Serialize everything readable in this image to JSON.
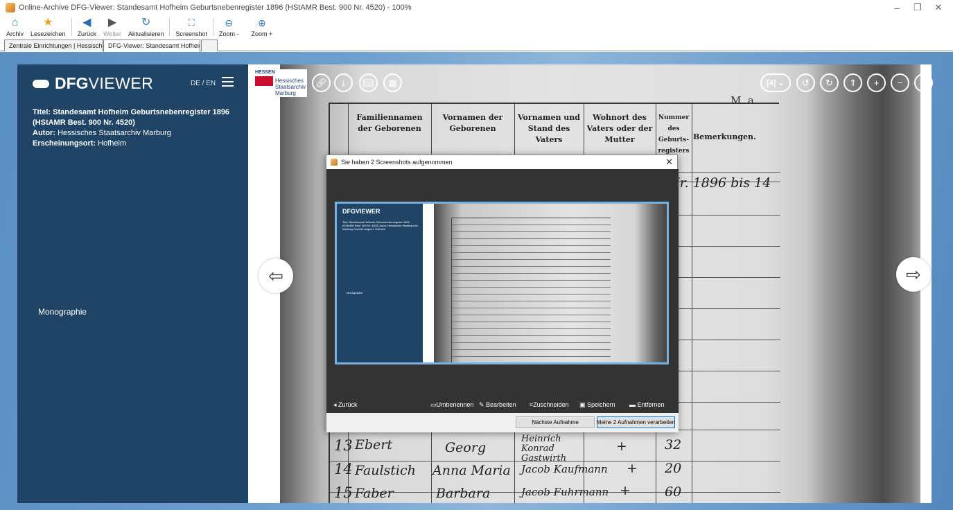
{
  "window": {
    "title": "Online-Archive DFG-Viewer: Standesamt Hofheim Geburtsnebenregister 1896 (HStAMR Best. 900 Nr. 4520) - 100%",
    "controls": [
      "–",
      "❐",
      "✕"
    ]
  },
  "toolbar": {
    "archiv": "Archiv",
    "lesezeichen": "Lesezeichen",
    "zurueck": "Zurück",
    "weiter": "Weiter",
    "aktualisieren": "Aktualisieren",
    "screenshot": "Screenshot",
    "zoom_out": "Zoom -",
    "zoom_in": "Zoom +"
  },
  "tabs": [
    {
      "label": "Zentrale Einrichtungen | Hessische",
      "close": "×"
    },
    {
      "label": "DFG-Viewer: Standesamt Hofheim",
      "close": "×"
    }
  ],
  "sidebar": {
    "logo_bold": "DFG",
    "logo_light": "VIEWER",
    "lang": "DE / EN",
    "title_label": "Titel:",
    "title_value": "Standesamt Hofheim Geburtsnebenregister 1896 (HStAMR Best. 900 Nr. 4520)",
    "author_label": "Autor:",
    "author_value": "Hessisches Staatsarchiv Marburg",
    "place_label": "Erscheinungsort:",
    "place_value": "Hofheim",
    "genre": "Monographie"
  },
  "institution": {
    "top": "HESSEN",
    "line1": "Hessisches",
    "line2": "Staatsarchiv",
    "line3": "Marburg"
  },
  "viewer": {
    "page_selector": "[4]",
    "document_header": "M. a.",
    "columns": [
      "Familiennamen der Geborenen",
      "Vornamen der Geborenen",
      "Vornamen und Stand des Vaters",
      "Wohnort des Vaters oder der Mutter",
      "Nummer des Geburts-registers",
      "Bemerkungen."
    ],
    "rows": [
      {
        "num": "13",
        "family": "Ebert",
        "given": "Georg",
        "father": "Heinrich Konrad Gastwirth",
        "dot": "+",
        "reg": "32"
      },
      {
        "num": "14",
        "family": "Faulstich",
        "given": "Anna Maria",
        "father": "Jacob Kaufmann",
        "dot": "+",
        "reg": "20"
      },
      {
        "num": "15",
        "family": "Faber",
        "given": "Barbara",
        "father": "Jacob Fuhrmann",
        "dot": "+",
        "reg": "60"
      }
    ],
    "remark": "Nr. 1896 bis 14"
  },
  "dialog": {
    "title": "Sie haben 2 Screenshots aufgenommen",
    "close": "✕",
    "back": "Zurück",
    "rename": "Umbenennen",
    "edit": "Bearbeiten",
    "crop": "Zuschneiden",
    "save": "Speichern",
    "remove": "Entfernen",
    "next": "Nächste Aufnahme",
    "process": "Meine 2 Aufnahmen verarbeiten",
    "thumb": {
      "logo": "DFGVIEWER",
      "meta": "Titel: Standesamt Hofheim Geburtsnebenregister 1896 (HStAMR Best. 900 Nr. 4520) Autor: Hessisches Staatsarchiv Marburg Erscheinungsort: Hofheim",
      "genre": "Monographie"
    }
  },
  "colors": {
    "sidebar": "#1f4466",
    "background": "#6ea0cf",
    "dialog_body": "#333333",
    "thumb_border": "#7ab0e0"
  }
}
